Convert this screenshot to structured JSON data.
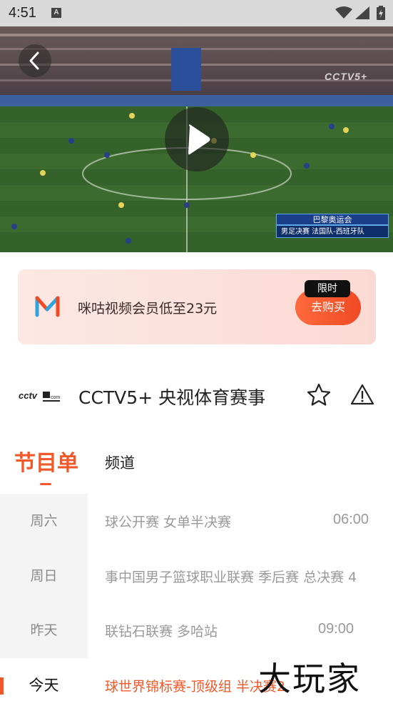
{
  "status_bar": {
    "time": "4:51",
    "notification_icon": "A"
  },
  "video": {
    "watermark": "CCTV5+",
    "scoreboard": {
      "top": "巴黎奥运会",
      "bottom": "男足决赛  法国队-西班牙队"
    }
  },
  "promo": {
    "text": "咪咕视频会员低至23元",
    "buy_label": "去购买",
    "badge": "限时",
    "logo_icon": "migu-logo-icon"
  },
  "channel": {
    "name": "CCTV5+ 央视体育赛事",
    "logo_text": "cctv"
  },
  "tabs": {
    "schedule": "节目单",
    "channel": "频道"
  },
  "days": [
    {
      "label": "周六"
    },
    {
      "label": "周日"
    },
    {
      "label": "昨天"
    },
    {
      "label": "今天"
    }
  ],
  "programs": [
    {
      "name": "球公开赛 女单半决赛",
      "time": "06:00"
    },
    {
      "name": "事中国男子篮球职业联赛 季后赛 总决赛 4",
      "time": ""
    },
    {
      "name": "联钻石联赛 多哈站",
      "time": "09:00"
    },
    {
      "name": "球世界锦标赛-顶级组 半决赛2",
      "time": ""
    }
  ],
  "watermark_brand": "大玩家",
  "colors": {
    "accent": "#f2592a",
    "promo_bg": "#fde8e4",
    "sidebar_bg": "#f4f4f4"
  }
}
